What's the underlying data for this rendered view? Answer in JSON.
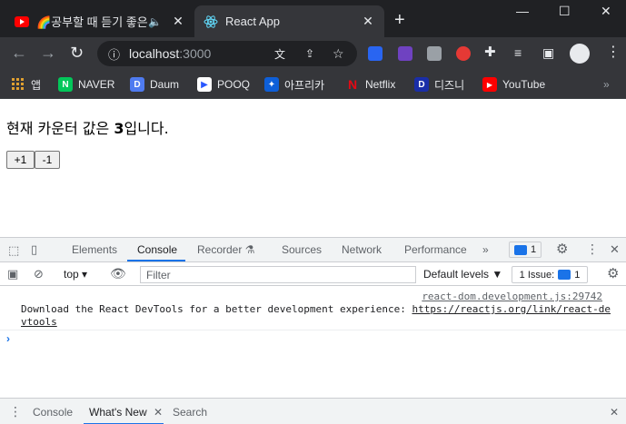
{
  "browser": {
    "tabs": [
      {
        "title": "🌈공부할 때 듣기 좋은",
        "active": false
      },
      {
        "title": "React App",
        "active": true
      }
    ],
    "new_tab_glyph": "+",
    "address": {
      "host": "localhost",
      "port": ":3000"
    },
    "window_controls": [
      "—",
      "☐",
      "✕"
    ],
    "bookmarks": [
      {
        "label": "앱",
        "icon": "apps-grid-icon",
        "color": "#e8eaed"
      },
      {
        "label": "NAVER",
        "icon": "naver-icon",
        "color": "#03c75a",
        "glyph": "N"
      },
      {
        "label": "Daum",
        "icon": "daum-icon",
        "color": "#4f7bf0",
        "glyph": "D"
      },
      {
        "label": "POOQ",
        "icon": "pooq-icon",
        "color": "#2957ff",
        "glyph": "▶"
      },
      {
        "label": "아프리카",
        "icon": "afreeca-icon",
        "color": "#0e5fd8",
        "glyph": "✦"
      },
      {
        "label": "Netflix",
        "icon": "netflix-icon",
        "color": "#e50914",
        "glyph": "N"
      },
      {
        "label": "디즈니",
        "icon": "disney-icon",
        "color": "#1a2ea8",
        "glyph": "D"
      },
      {
        "label": "YouTube",
        "icon": "youtube-icon",
        "color": "#ff0000",
        "glyph": "▶"
      }
    ],
    "bookmarks_overflow": "»"
  },
  "page": {
    "counter_prefix": "현재 카운터 값은 ",
    "counter_value": "3",
    "counter_suffix": "입니다.",
    "increment_label": "+1",
    "decrement_label": "-1"
  },
  "devtools": {
    "tabs": [
      "Elements",
      "Console",
      "Recorder ⚗",
      "Sources",
      "Network",
      "Performance"
    ],
    "active_tab": "Console",
    "more": "»",
    "message_badge": "1",
    "context": "top",
    "filter_placeholder": "Filter",
    "levels": "Default levels ▼",
    "issues_label": "1 Issue:",
    "issues_count": "1",
    "message_source": "react-dom.development.js:29742",
    "message_text": "Download the React DevTools for a better development experience: ",
    "message_link": "https://reactjs.org/link/react-devtools",
    "prompt": "›"
  },
  "drawer": {
    "tabs": [
      "Console",
      "What's New",
      "Search"
    ],
    "active_tab": "What's New",
    "close": "✕"
  }
}
